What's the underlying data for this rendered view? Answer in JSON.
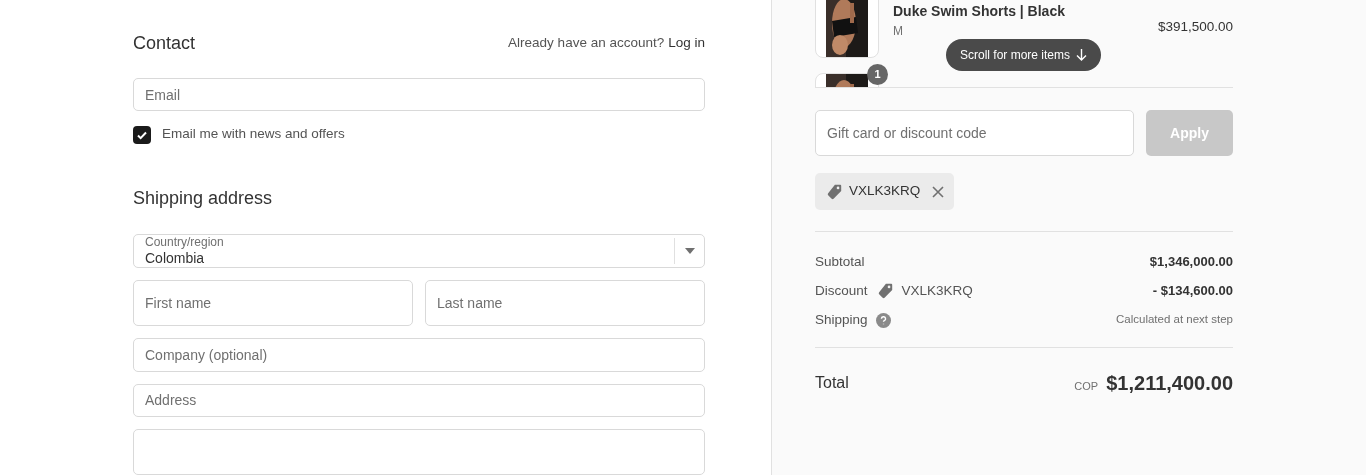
{
  "contact": {
    "title": "Contact",
    "account_prompt": "Already have an account?",
    "login_link": "Log in",
    "email": {
      "placeholder": "Email"
    },
    "newsletter": {
      "label": "Email me with news and offers",
      "checked": true
    }
  },
  "shipping": {
    "title": "Shipping address",
    "country": {
      "label": "Country/region",
      "value": "Colombia"
    },
    "first_name": {
      "placeholder": "First name"
    },
    "last_name": {
      "placeholder": "Last name"
    },
    "company": {
      "placeholder": "Company (optional)"
    },
    "address": {
      "placeholder": "Address"
    }
  },
  "order": {
    "items": [
      {
        "name": "Duke Swim Shorts | Black",
        "variant": "M",
        "price": "$391,500.00"
      },
      {
        "quantity": "1"
      }
    ],
    "scroll_hint": "Scroll for more items",
    "discount_field": {
      "placeholder": "Gift card or discount code"
    },
    "apply_button": {
      "label": "Apply",
      "disabled": true
    },
    "applied_code": "VXLK3KRQ",
    "subtotal": {
      "label": "Subtotal",
      "value": "$1,346,000.00"
    },
    "discount": {
      "label": "Discount",
      "code": "VXLK3KRQ",
      "value": "- $134,600.00"
    },
    "shipping_line": {
      "label": "Shipping",
      "value": "Calculated at next step"
    },
    "total": {
      "label": "Total",
      "currency": "COP",
      "value": "$1,211,400.00"
    }
  }
}
